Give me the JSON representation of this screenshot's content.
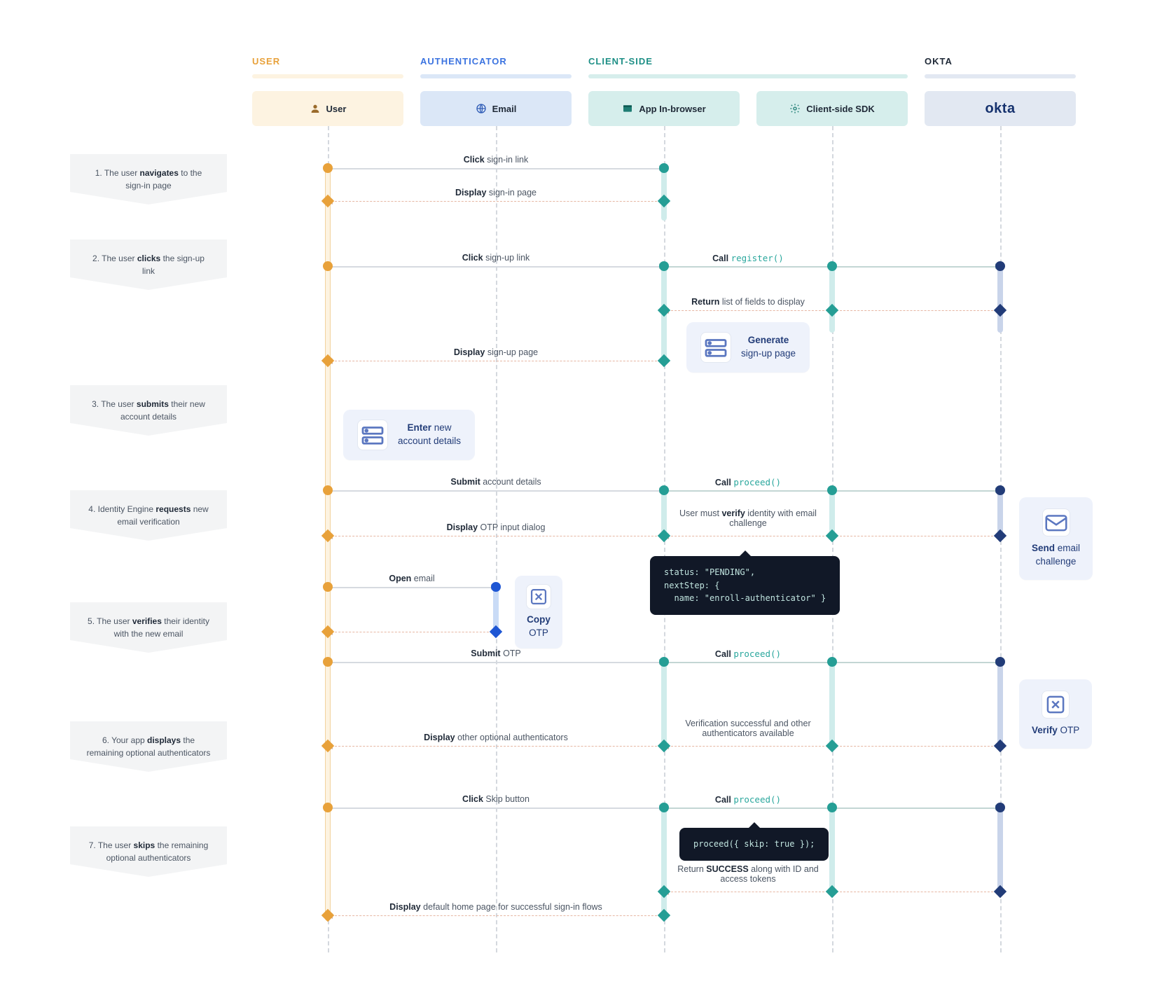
{
  "lanes": {
    "user": {
      "title": "USER",
      "box": "User"
    },
    "auth": {
      "title": "AUTHENTICATOR",
      "box": "Email"
    },
    "client": {
      "title": "CLIENT-SIDE",
      "box1": "App In-browser",
      "box2": "Client-side SDK"
    },
    "okta": {
      "title": "OKTA",
      "logo": "okta"
    }
  },
  "steps": {
    "s1": {
      "pre": "1. The user ",
      "bold": "navigates",
      "post": " to the sign-in page"
    },
    "s2": {
      "pre": "2. The user ",
      "bold": "clicks",
      "post": " the sign-up link"
    },
    "s3": {
      "pre": "3. The user ",
      "bold": "submits",
      "post": " their new account details"
    },
    "s4": {
      "pre": "4. Identity Engine ",
      "bold": "requests",
      "post": " new email verification"
    },
    "s5": {
      "pre": "5. The user ",
      "bold": "verifies",
      "post": " their identity with the new email"
    },
    "s6": {
      "pre": "6. Your app ",
      "bold": "displays",
      "post": " the remaining optional authenticators"
    },
    "s7": {
      "pre": "7. The user ",
      "bold": "skips",
      "post": " the remaining optional authenticators"
    }
  },
  "labels": {
    "l1": {
      "b": "Click",
      "t": " sign-in link"
    },
    "l2": {
      "b": "Display",
      "t": " sign-in page"
    },
    "l3": {
      "b": "Click",
      "t": " sign-up link"
    },
    "l4": {
      "b": "Call ",
      "fn": "register()"
    },
    "l5": {
      "b": "Return",
      "t": " list of fields to display"
    },
    "l6": {
      "b": "Display",
      "t": " sign-up page"
    },
    "l7": {
      "b": "Submit",
      "t": " account details"
    },
    "l8": {
      "b": "Call ",
      "fn": "proceed()"
    },
    "l9": {
      "pre": "User must ",
      "b": "verify",
      "t": " identity with email challenge"
    },
    "l10": {
      "b": "Display",
      "t": " OTP input dialog"
    },
    "l11": {
      "b": "Open",
      "t": " email"
    },
    "l12": {
      "b": "Submit",
      "t": " OTP"
    },
    "l13": {
      "b": "Call ",
      "fn": "proceed()"
    },
    "l14": {
      "pre": "Verification successful and other authenticators available"
    },
    "l15": {
      "b": "Display",
      "t": " other optional authenticators"
    },
    "l16": {
      "b": "Click",
      "t": " Skip button"
    },
    "l17": {
      "b": "Call ",
      "fn": "proceed()"
    },
    "l18": {
      "pre": "Return ",
      "b": "SUCCESS",
      "t": " along with ID and access tokens"
    },
    "l19": {
      "b": "Display",
      "t": " default home page for successful sign-in flows"
    }
  },
  "callouts": {
    "generate": {
      "b": "Generate",
      "t": "sign-up page"
    },
    "enter": {
      "b": "Enter",
      "t": " new",
      "t2": "account details"
    },
    "send": {
      "b": "Send",
      "t": " email",
      "t2": "challenge"
    },
    "copy": {
      "b": "Copy",
      "t": "OTP"
    },
    "verify": {
      "b": "Verify",
      "t": " OTP"
    }
  },
  "code": {
    "c1": "status: \"PENDING\",\nnextStep: {\n  name: \"enroll-authenticator\" }",
    "c2": "proceed({ skip: true });"
  }
}
